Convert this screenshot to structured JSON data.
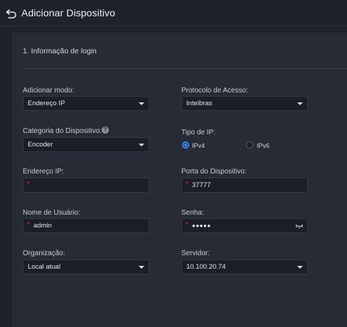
{
  "header": {
    "title": "Adicionar Dispositivo"
  },
  "section": {
    "title": "1. Informação de login"
  },
  "form": {
    "add_mode": {
      "label": "Adicionar modo:",
      "value": "Endereço IP"
    },
    "access_protocol": {
      "label": "Protocolo de Acesso:",
      "value": "Intelbras"
    },
    "device_category": {
      "label": "Categoria do Dispositivo:",
      "value": "Encoder"
    },
    "ip_type": {
      "label": "Tipo de IP:",
      "options": [
        "IPv4",
        "IPv6"
      ],
      "selected": "IPv4"
    },
    "ip_address": {
      "label": "Endereço IP:",
      "required_mark": "*",
      "value": ""
    },
    "device_port": {
      "label": "Porta do Dispositivo:",
      "required_mark": "*",
      "value": "37777"
    },
    "username": {
      "label": "Nome de Usuário:",
      "required_mark": "*",
      "value": "admin"
    },
    "password": {
      "label": "Senha:",
      "required_mark": "*",
      "value": "●●●●●"
    },
    "organization": {
      "label": "Organização:",
      "value": "Local atual"
    },
    "server": {
      "label": "Servidor:",
      "value": "10.100.20.74"
    }
  },
  "icons": {
    "back": "back-arrow-icon",
    "help": "question-mark-icon",
    "dropdown": "chevron-down-icon",
    "eye": "eye-hidden-icon"
  },
  "colors": {
    "background": "#1f222b",
    "panel": "#272b36",
    "input": "#1b1e25",
    "accent": "#3a8cff",
    "required": "#e0353d"
  }
}
